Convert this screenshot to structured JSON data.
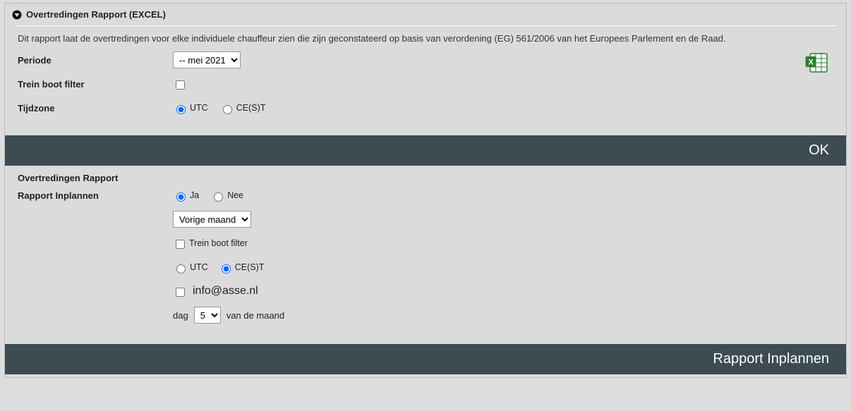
{
  "header": {
    "title": "Overtredingen Rapport (EXCEL)"
  },
  "description": "Dit rapport laat de overtredingen voor elke individuele chauffeur zien die zijn geconstateerd op basis van verordening (EG) 561/2006 van het Europees Parlement en de Raad.",
  "form": {
    "periode_label": "Periode",
    "periode_value": "-- mei 2021",
    "trein_label": "Trein boot filter",
    "tijdzone_label": "Tijdzone",
    "tz_utc": "UTC",
    "tz_cest": "CE(S)T"
  },
  "buttons": {
    "ok": "OK",
    "rapport_inplannen": "Rapport Inplannen"
  },
  "schedule": {
    "section_title": "Overtredingen Rapport",
    "inplannen_label": "Rapport Inplannen",
    "ja": "Ja",
    "nee": "Nee",
    "range_value": "Vorige maand",
    "trein_label2": "Trein boot filter",
    "tz_utc2": "UTC",
    "tz_cest2": "CE(S)T",
    "email": "info@asse.nl",
    "dag_prefix": "dag",
    "dag_value": "5",
    "dag_suffix": "van de maand"
  }
}
